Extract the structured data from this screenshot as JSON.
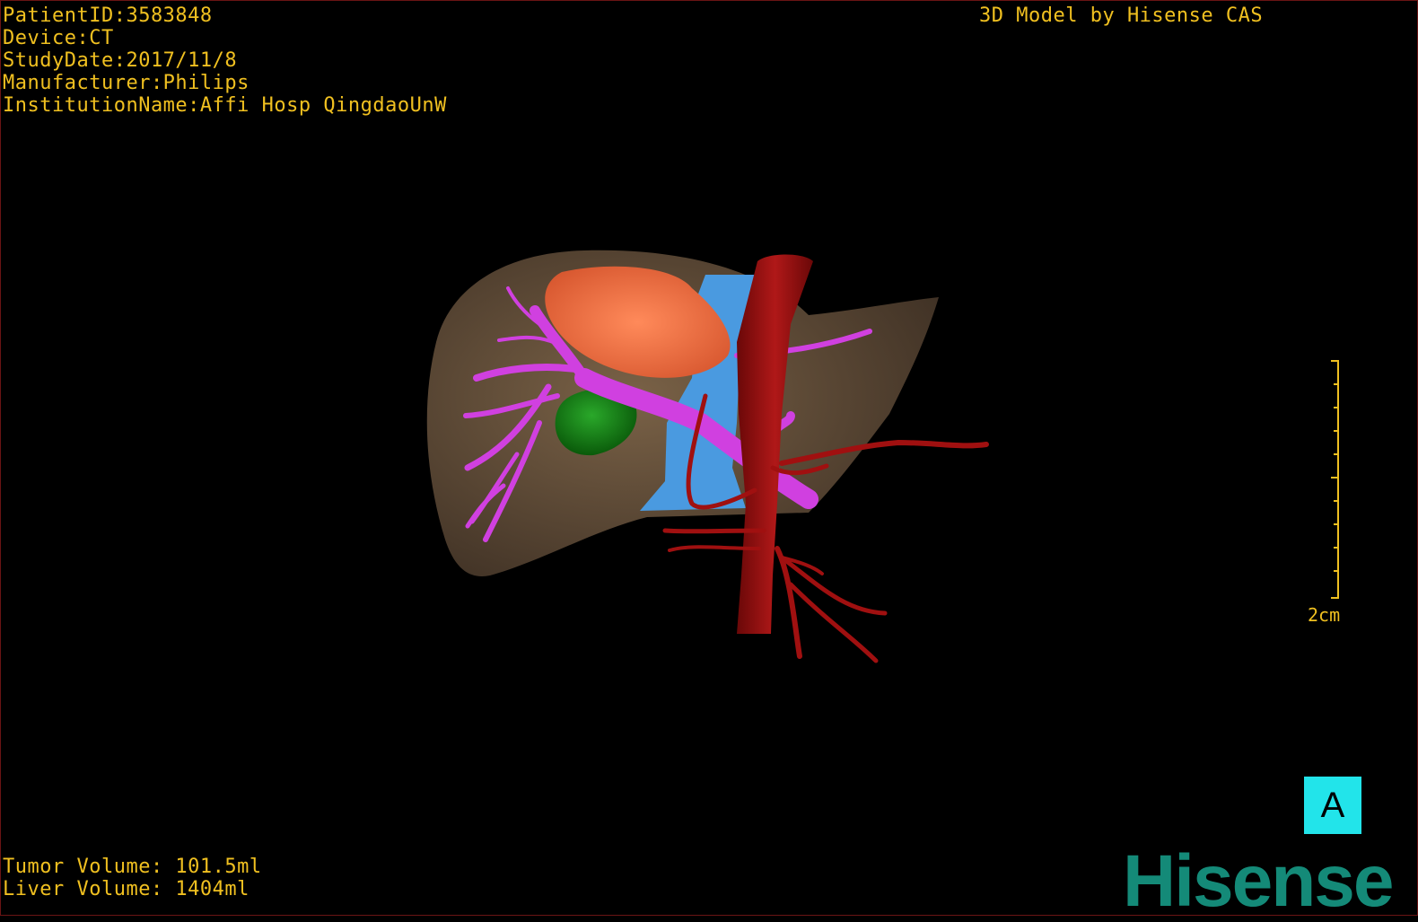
{
  "header": {
    "patient_id": "PatientID:3583848",
    "device": "Device:CT",
    "study_date": "StudyDate:2017/11/8",
    "manufacturer": "Manufacturer:Philips",
    "institution": "InstitutionName:Affi Hosp QingdaoUnW",
    "brand_caption": "3D Model by Hisense CAS"
  },
  "volumes": {
    "tumor": "Tumor Volume: 101.5ml",
    "liver": "Liver Volume: 1404ml"
  },
  "scale": {
    "label": "2cm"
  },
  "orientation": {
    "label": "A"
  },
  "logo": {
    "text": "Hisense"
  },
  "colors": {
    "overlay_text": "#f0c020",
    "liver": "#6b5640",
    "tumor": "#f07048",
    "portal_vein": "#d040e0",
    "ivc": "#4a9ae0",
    "aorta": "#a01010",
    "gallbladder": "#1a8a1a",
    "orientation_box": "#22e4ea",
    "logo": "#148a78"
  }
}
